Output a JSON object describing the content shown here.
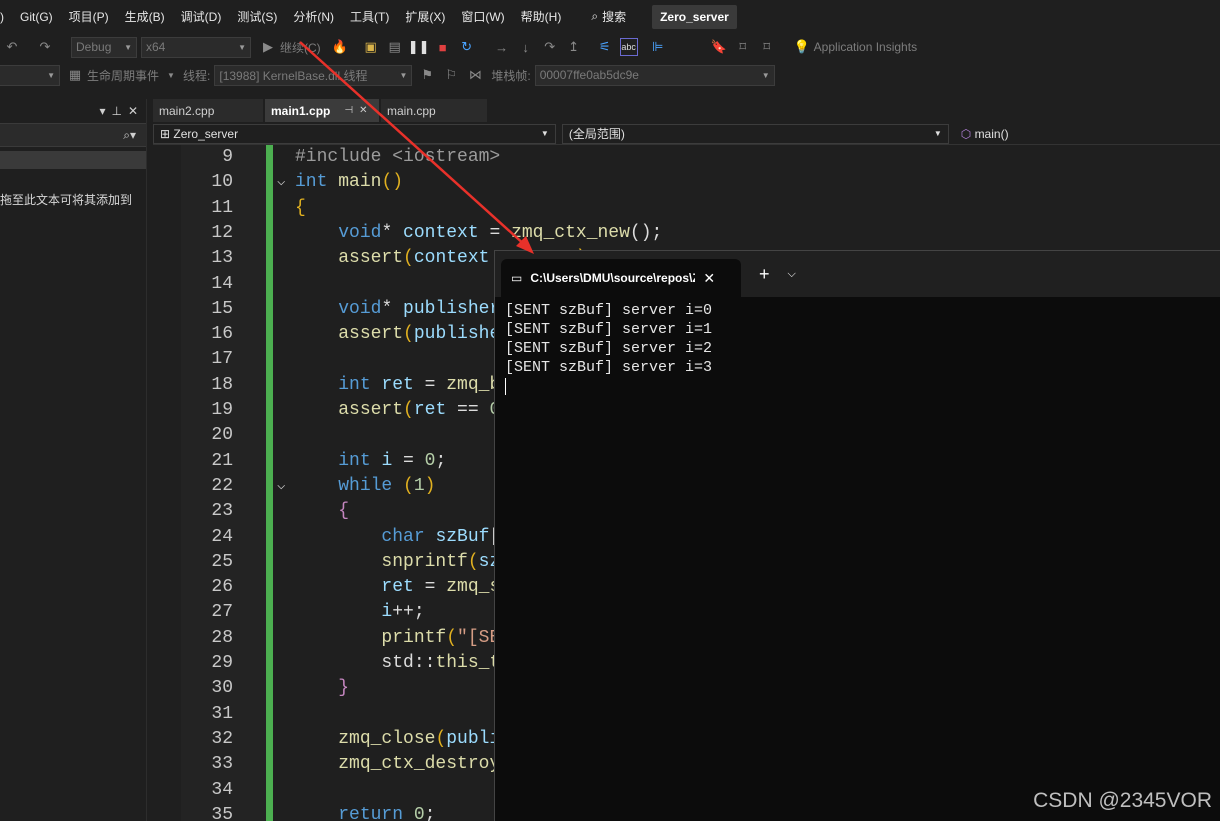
{
  "menu": {
    "items": [
      ")",
      "Git(G)",
      "项目(P)",
      "生成(B)",
      "调试(D)",
      "测试(S)",
      "分析(N)",
      "工具(T)",
      "扩展(X)",
      "窗口(W)",
      "帮助(H)"
    ],
    "search_label": "搜索",
    "solution_name": "Zero_server"
  },
  "toolbar": {
    "config": "Debug",
    "platform": "x64",
    "continue_label": "继续(C)",
    "app_insights": "Application Insights",
    "lifecycle_label": "生命周期事件",
    "thread_label": "线程:",
    "thread_value": "[13988] KernelBase.dll 线程",
    "stack_label": "堆栈帧:",
    "stack_value": "00007ffe0ab5dc9e"
  },
  "left_panel": {
    "hint": "拖至此文本可将其添加到"
  },
  "tabs": [
    {
      "label": "main2.cpp",
      "active": false
    },
    {
      "label": "main1.cpp",
      "active": true
    },
    {
      "label": "main.cpp",
      "active": false
    }
  ],
  "nav": {
    "project": "Zero_server",
    "scope": "(全局范围)",
    "member": "main()"
  },
  "code_lines": [
    9,
    10,
    11,
    12,
    13,
    14,
    15,
    16,
    17,
    18,
    19,
    20,
    21,
    22,
    23,
    24,
    25,
    26,
    27,
    28,
    29,
    30,
    31,
    32,
    33,
    34,
    35
  ],
  "terminal": {
    "tab_title": "C:\\Users\\DMU\\source\\repos\\Z",
    "lines": [
      "[SENT szBuf] server i=0",
      "[SENT szBuf] server i=1",
      "[SENT szBuf] server i=2",
      "[SENT szBuf] server i=3"
    ]
  },
  "watermark": "CSDN @2345VOR",
  "colors": {
    "accent_green": "#4caf50",
    "arrow_red": "#e8312a",
    "keyword_blue": "#569cd6"
  }
}
